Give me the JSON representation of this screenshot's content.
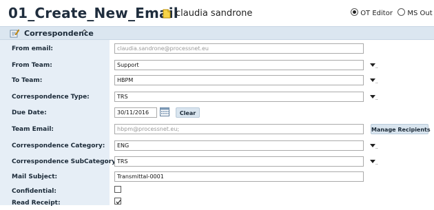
{
  "header": {
    "title": "01_Create_New_Email",
    "user_name": "claudia sandrone",
    "editor_options": [
      {
        "label": "OT Editor",
        "selected": true
      },
      {
        "label": "MS Out",
        "selected": false
      }
    ]
  },
  "section": {
    "title": "Correspondence",
    "chevron": "^"
  },
  "form": {
    "from_email": {
      "label": "From email:",
      "value": "claudia.sandrone@processnet.eu"
    },
    "from_team": {
      "label": "From Team:",
      "value": "Support"
    },
    "to_team": {
      "label": "To Team:",
      "value": "HBPM"
    },
    "correspondence_type": {
      "label": "Correspondence Type:",
      "value": "TRS"
    },
    "due_date": {
      "label": "Due Date:",
      "value": "30/11/2016",
      "clear_label": "Clear"
    },
    "team_email": {
      "label": "Team Email:",
      "value": "hbpm@processnet.eu;",
      "manage_label": "Manage Recipients"
    },
    "correspondence_category": {
      "label": "Correspondence Category:",
      "value": "ENG"
    },
    "correspondence_subcategory": {
      "label": "Correspondence SubCategory:",
      "value": "TRS"
    },
    "mail_subject": {
      "label": "Mail Subject:",
      "value": "Transmittal-0001"
    },
    "confidential": {
      "label": "Confidential:",
      "checked": false
    },
    "read_receipt": {
      "label": "Read Receipt:",
      "checked": true
    }
  },
  "dropdown_suffix": "..",
  "colors": {
    "section_bar": "#dbe6f0",
    "label_column": "#e6eef6",
    "button": "#d9e5ef"
  }
}
